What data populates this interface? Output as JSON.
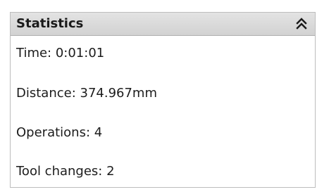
{
  "panel": {
    "title": "Statistics",
    "toggle_icon": "double-chevron-up-icon"
  },
  "stats": {
    "time": "Time: 0:01:01",
    "distance": "Distance: 374.967mm",
    "operations": "Operations: 4",
    "tool_changes": "Tool changes: 2"
  }
}
